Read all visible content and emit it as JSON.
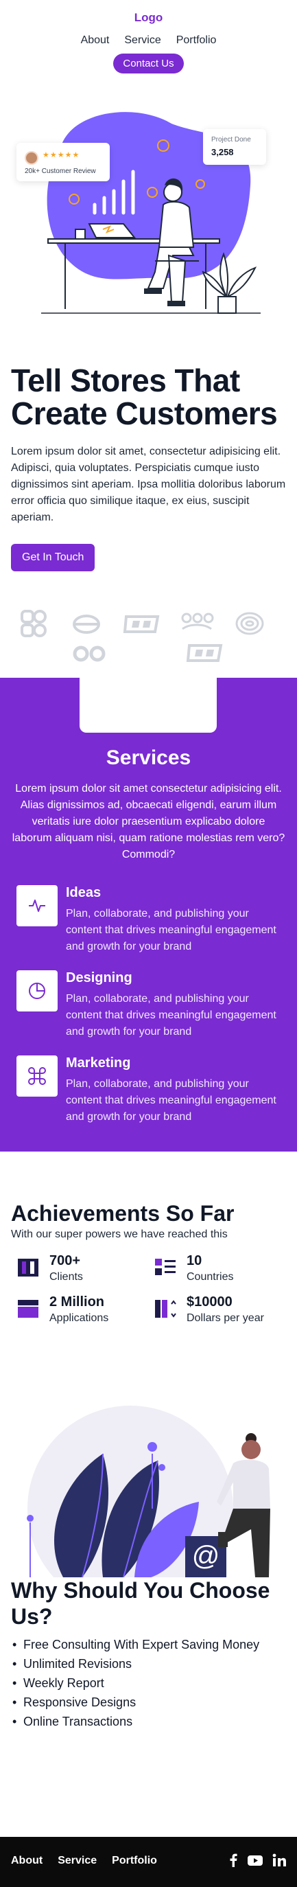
{
  "header": {
    "logo": "Logo",
    "nav": [
      "About",
      "Service",
      "Portfolio"
    ],
    "cta": "Contact Us"
  },
  "hero": {
    "review_card": {
      "stars": "★★★★★",
      "text": "20k+ Customer Review"
    },
    "project_card": {
      "label": "Project Done",
      "value": "3,258"
    },
    "title": "Tell Stores That Create Customers",
    "description": "Lorem ipsum dolor sit amet, consectetur adipisicing elit. Adipisci, quia voluptates. Perspiciatis cumque iusto dignissimos sint aperiam. Ipsa mollitia doloribus laborum error officia quo similique itaque, ex eius, suscipit aperiam.",
    "button": "Get In Touch"
  },
  "services": {
    "title": "Services",
    "description": "Lorem ipsum dolor sit amet consectetur adipisicing elit. Alias dignissimos ad, obcaecati eligendi, earum illum veritatis iure dolor praesentium explicabo dolore laborum aliquam nisi, quam ratione molestias rem vero? Commodi?",
    "items": [
      {
        "name": "Ideas",
        "icon": "pulse-icon",
        "text": "Plan, collaborate, and publishing your content that drives meaningful engagement and growth for your brand"
      },
      {
        "name": "Designing",
        "icon": "pie-chart-icon",
        "text": "Plan, collaborate, and publishing your content that drives meaningful engagement and growth for your brand"
      },
      {
        "name": "Marketing",
        "icon": "command-icon",
        "text": "Plan, collaborate, and publishing your content that drives meaningful engagement and growth for your brand"
      }
    ]
  },
  "achievements": {
    "title": "Achievements So Far",
    "subtitle": "With our super powers we have reached this",
    "stats": [
      {
        "value": "700+",
        "label": "Clients"
      },
      {
        "value": "10",
        "label": "Countries"
      },
      {
        "value": "2 Million",
        "label": "Applications"
      },
      {
        "value": "$10000",
        "label": "Dollars per year"
      }
    ]
  },
  "why": {
    "title": "Why Should You Choose Us?",
    "reasons": [
      "Free Consulting With Expert Saving Money",
      "Unlimited Revisions",
      "Weekly Report",
      "Responsive Designs",
      "Online Transactions"
    ]
  },
  "footer": {
    "nav": [
      "About",
      "Service",
      "Portfolio"
    ],
    "social": [
      "facebook-icon",
      "youtube-icon",
      "linkedin-icon"
    ]
  },
  "colors": {
    "accent": "#7a2bd1",
    "footer": "#0b0b0b",
    "light_purple": "#7b61ff"
  }
}
